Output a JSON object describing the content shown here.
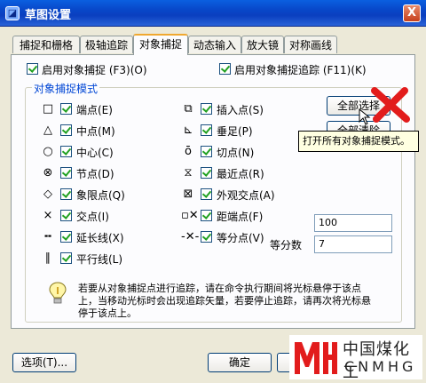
{
  "window": {
    "title": "草图设置",
    "close_glyph": "X"
  },
  "tabs": [
    {
      "label": "捕捉和栅格"
    },
    {
      "label": "极轴追踪"
    },
    {
      "label": "对象捕捉",
      "active": true
    },
    {
      "label": "动态输入"
    },
    {
      "label": "放大镜"
    },
    {
      "label": "对称画线"
    }
  ],
  "options": {
    "enable_osnap": "启用对象捕捉 (F3)(O)",
    "enable_tracking": "启用对象捕捉追踪 (F11)(K)"
  },
  "group_title": "对象捕捉模式",
  "snap_left": [
    {
      "icon": "square-icon",
      "label": "端点(E)"
    },
    {
      "icon": "triangle-icon",
      "label": "中点(M)"
    },
    {
      "icon": "circle-icon",
      "label": "中心(C)"
    },
    {
      "icon": "circle-x-icon",
      "label": "节点(D)"
    },
    {
      "icon": "diamond-icon",
      "label": "象限点(Q)"
    },
    {
      "icon": "x-icon",
      "label": "交点(I)"
    },
    {
      "icon": "extension-icon",
      "label": "延长线(X)"
    },
    {
      "icon": "parallel-icon",
      "label": "平行线(L)"
    }
  ],
  "snap_right": [
    {
      "icon": "insert-icon",
      "label": "插入点(S)"
    },
    {
      "icon": "perpendicular-icon",
      "label": "垂足(P)"
    },
    {
      "icon": "tangent-icon",
      "label": "切点(N)"
    },
    {
      "icon": "hourglass-icon",
      "label": "最近点(R)"
    },
    {
      "icon": "box-x-icon",
      "label": "外观交点(A)"
    },
    {
      "icon": "distance-icon",
      "label": "距端点(F)"
    },
    {
      "icon": "divide-icon",
      "label": "等分点(V)"
    }
  ],
  "glyphs": {
    "square-icon": "□",
    "triangle-icon": "△",
    "circle-icon": "○",
    "circle-x-icon": "⊗",
    "diamond-icon": "◇",
    "x-icon": "×",
    "extension-icon": "╍",
    "parallel-icon": "∥",
    "insert-icon": "⧉",
    "perpendicular-icon": "⊾",
    "tangent-icon": "ō",
    "hourglass-icon": "⧖",
    "box-x-icon": "⊠",
    "distance-icon": "▫✕",
    "divide-icon": "-✕-"
  },
  "buttons": {
    "select_all": "全部选择",
    "clear_all": "全部清除",
    "options": "选项(T)...",
    "ok": "确定",
    "cancel": "取消"
  },
  "tooltip": "打开所有对象捕捉模式。",
  "distance_value": "100",
  "divide_label": "等分数",
  "divide_value": "7",
  "hint": "若要从对象捕捉点进行追踪，请在命令执行期间将光标悬停于该点上，当移动光标时会出现追踪矢量，若要停止追踪，请再次将光标悬停于该点上。",
  "watermark": {
    "cn": "中国煤化工",
    "en": "CNMHG"
  },
  "accent": "#e21c1c"
}
